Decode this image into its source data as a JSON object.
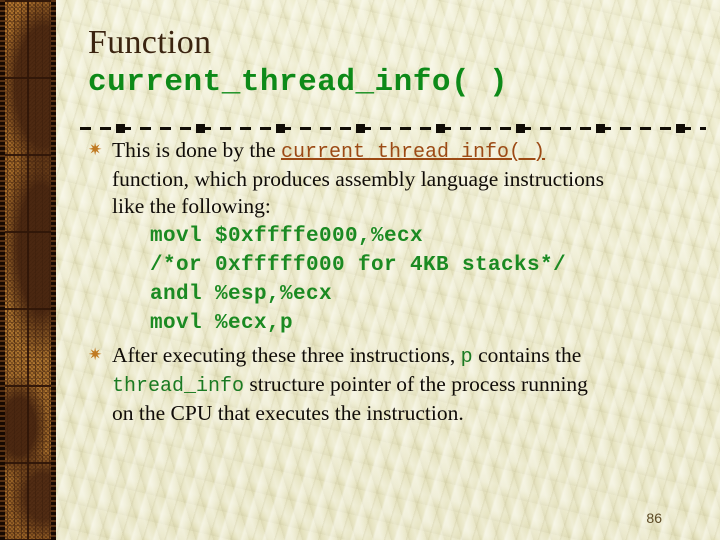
{
  "slide": {
    "title": "Function",
    "subtitle": "current_thread_info( )",
    "page_number": "86"
  },
  "colors": {
    "background": "#e9e6c6",
    "title": "#3b2410",
    "subtitle_green": "#0d8a18",
    "code_green": "#1b8a22",
    "link_rust": "#9c4a15",
    "body_text": "#100c08",
    "border_brown": "#a86e2a",
    "bullet": "#c07a22"
  },
  "icons": {
    "bullet_glyph": "✷",
    "bullet_name": "asterisk-bullet-icon"
  },
  "bullets": [
    {
      "id": "bullet-1",
      "text_before_link": "This is done by the ",
      "link_text": "current_thread_info( )",
      "line2": "function, which produces assembly language instructions",
      "line3": "like the following:",
      "code_lines": [
        "movl $0xffffe000,%ecx",
        "/*or 0xfffff000 for 4KB stacks*/",
        "andl %esp,%ecx",
        "movl %ecx,p"
      ]
    },
    {
      "id": "bullet-2",
      "seg1": "After executing these three instructions, ",
      "mono1": "p",
      "seg2": " contains the",
      "mono2": "thread_info",
      "seg3": " structure pointer of the process running",
      "seg4": "on the CPU that executes the instruction."
    }
  ]
}
